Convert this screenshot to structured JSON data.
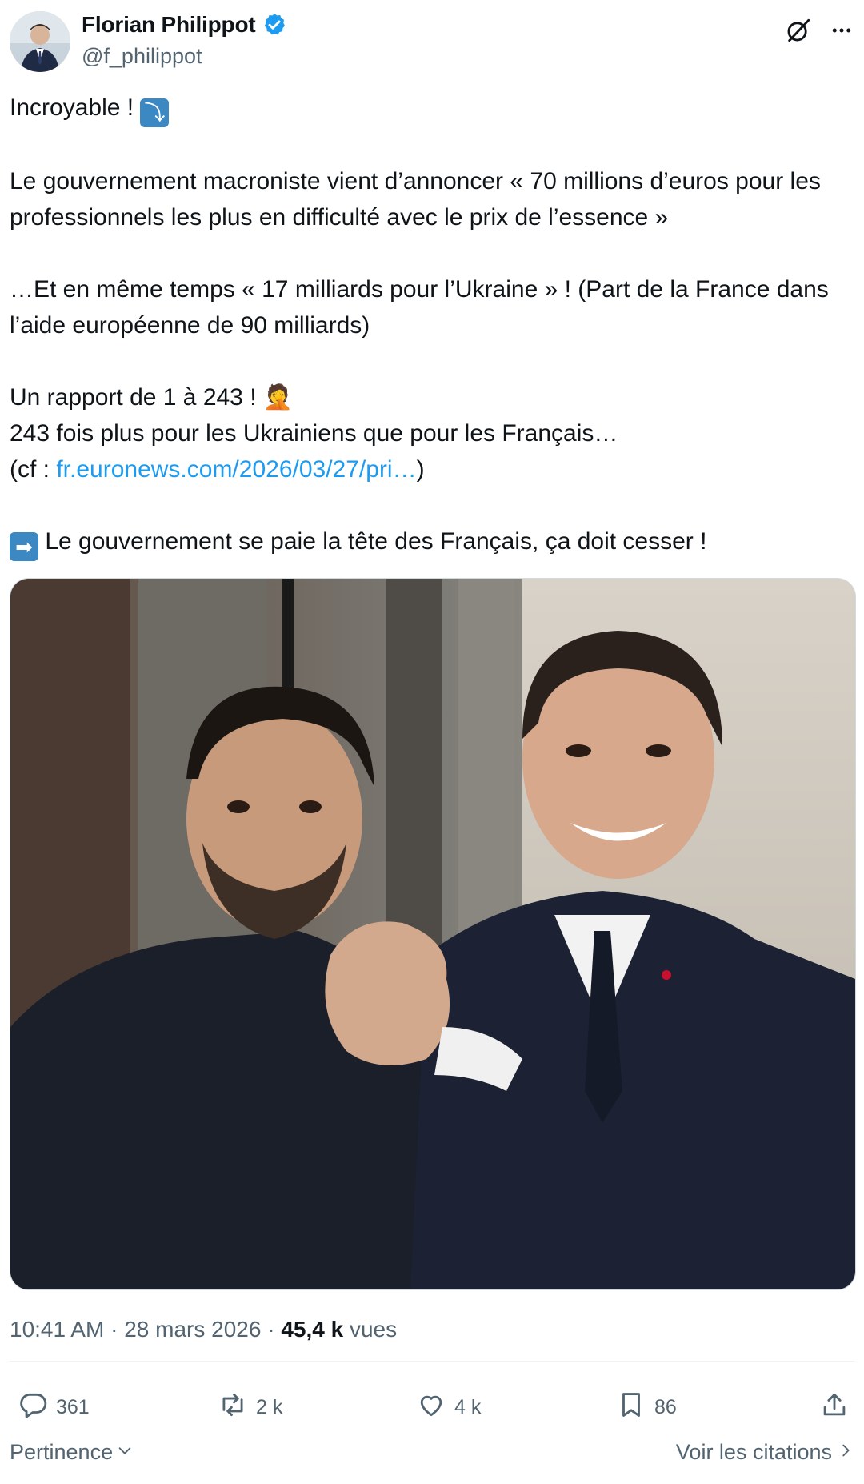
{
  "author": {
    "display_name": "Florian Philippot",
    "handle": "@f_philippot",
    "verified": true
  },
  "tweet": {
    "lines": {
      "l1": "Incroyable ! ",
      "l2": "Le gouvernement macroniste vient d’annoncer « 70 millions d’euros pour les professionnels les plus en difficulté avec le prix de l’essence »",
      "l3": "…Et en même temps « 17 milliards pour l’Ukraine » ! (Part de la France dans l’aide européenne de 90 milliards)",
      "l4": "Un rapport de 1 à 243 ! ",
      "l5": "243 fois plus pour les Ukrainiens que pour les Français…",
      "l6_prefix": "(cf : ",
      "l6_link": "fr.euronews.com/2026/03/27/pri…",
      "l6_suffix": ")",
      "l7": " Le gouvernement se paie la tête des Français, ça doit cesser !"
    },
    "emojis": {
      "arrow_down_right": "⤵",
      "facepalm": "🤦",
      "arrow_right": "➡"
    }
  },
  "meta": {
    "time": "10:41 AM",
    "date": "28 mars 2026",
    "views_count": "45,4 k",
    "views_label": "vues",
    "separator": "·"
  },
  "actions": {
    "reply": "361",
    "retweet": "2 k",
    "like": "4 k",
    "bookmark": "86"
  },
  "footer": {
    "sort_label": "Pertinence",
    "quotes_label": "Voir les citations"
  },
  "colors": {
    "verified_blue": "#1d9bf0",
    "link_blue": "#1d9bf0",
    "muted_text": "#536471",
    "primary_text": "#0f1419"
  },
  "icons": [
    "verified-badge-icon",
    "grok-icon",
    "more-icon",
    "reply-icon",
    "retweet-icon",
    "like-icon",
    "bookmark-icon",
    "share-icon",
    "chevron-down-icon",
    "chevron-right-icon"
  ]
}
